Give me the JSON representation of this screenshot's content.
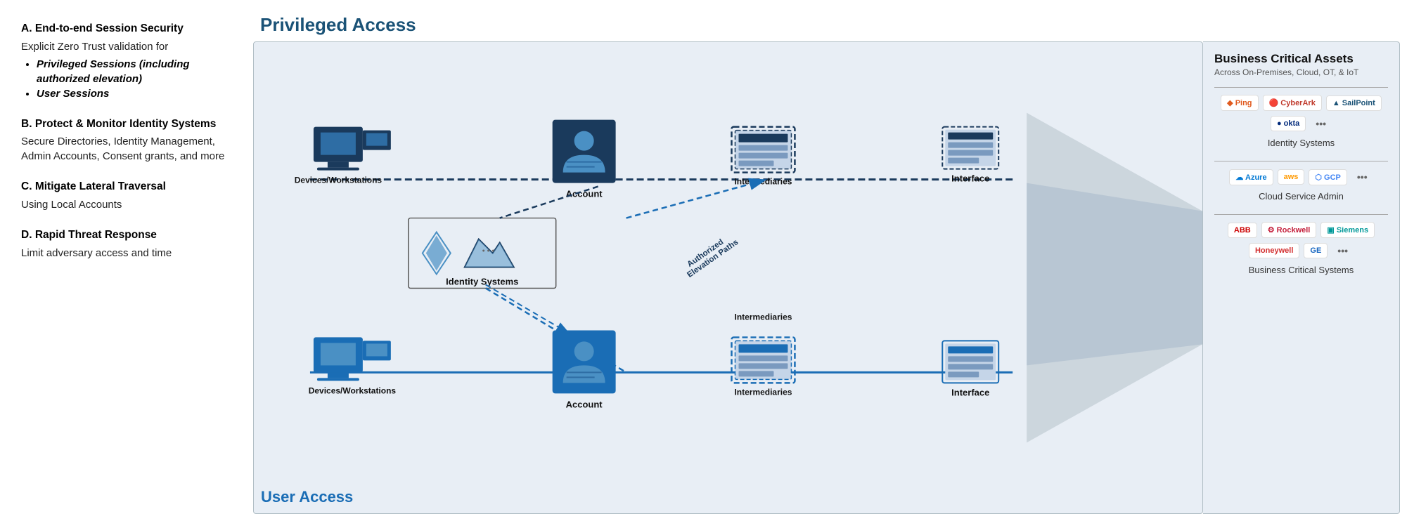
{
  "page": {
    "title": "Privileged Access",
    "user_access_label": "User Access"
  },
  "left_panel": {
    "sections": [
      {
        "id": "A",
        "title": "End-to-end Session Security",
        "body": "Explicit Zero Trust validation for",
        "bullets": [
          "Privileged Sessions (including authorized elevation)",
          "User Sessions"
        ]
      },
      {
        "id": "B",
        "title": "Protect & Monitor Identity Systems",
        "body": "Secure Directories, Identity Management, Admin Accounts, Consent grants, and more"
      },
      {
        "id": "C",
        "title": "Mitigate Lateral Traversal",
        "body": "Using Local Accounts"
      },
      {
        "id": "D",
        "title": "Rapid Threat Response",
        "body": "Limit adversary access and time"
      }
    ]
  },
  "privileged_row": {
    "nodes": [
      "Devices/Workstations",
      "Account",
      "Intermediaries",
      "Interface"
    ],
    "identity_systems_label": "Identity Systems",
    "elevation_label": "Authorized Elevation Paths"
  },
  "user_row": {
    "nodes": [
      "Devices/Workstations",
      "Account",
      "Intermediaries",
      "Interface"
    ]
  },
  "right_panel": {
    "title": "Business Critical Assets",
    "subtitle": "Across On-Premises, Cloud, OT, & IoT",
    "sections": [
      {
        "label": "Identity Systems",
        "logos": [
          "Ping",
          "CyberArk",
          "SailPoint",
          "Okta",
          "..."
        ]
      },
      {
        "label": "Cloud Service Admin",
        "logos": [
          "Azure",
          "AWS",
          "GCP",
          "..."
        ]
      },
      {
        "label": "Business Critical Systems",
        "logos": [
          "ABB",
          "Rockwell Automation",
          "Siemens",
          "Honeywell",
          "GE",
          "..."
        ]
      }
    ]
  }
}
